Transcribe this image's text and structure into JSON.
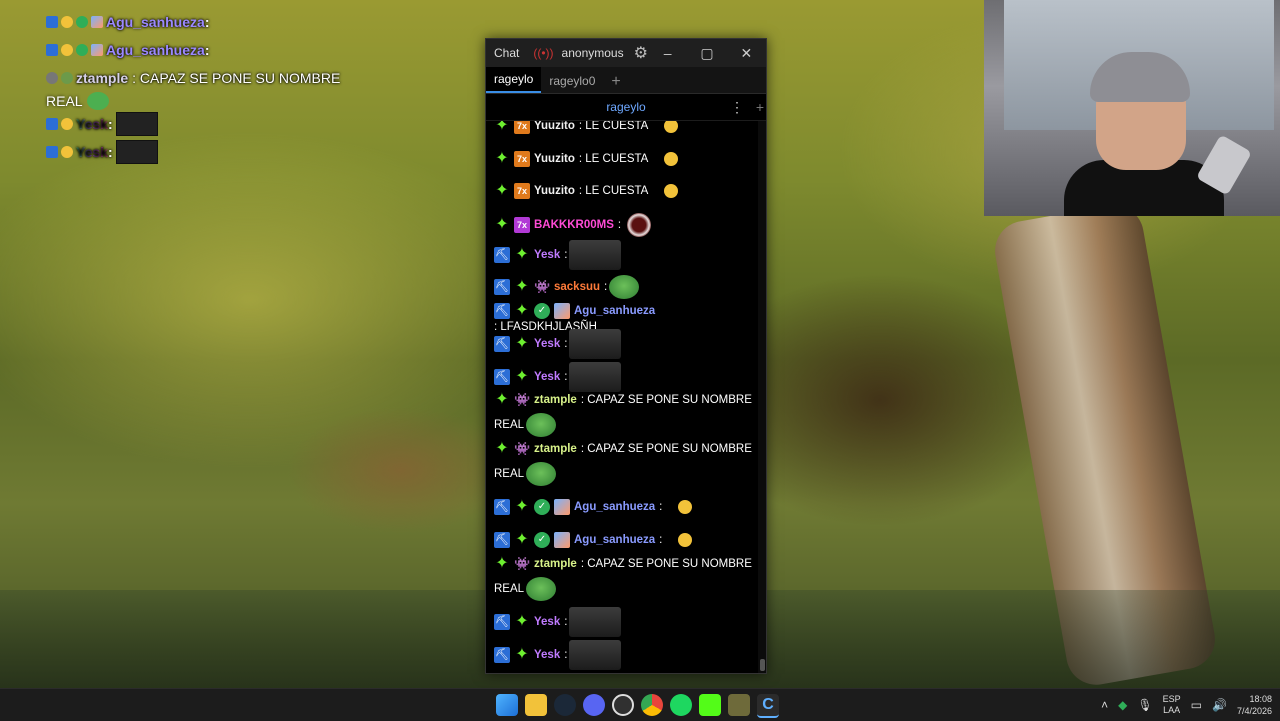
{
  "overlay": {
    "lines": [
      {
        "name": "Agu_sanhueza",
        "suffix": ":"
      },
      {
        "name": "Agu_sanhueza",
        "suffix": ":"
      },
      {
        "name": "ztample",
        "text": ": CAPAZ SE PONE SU NOMBRE"
      },
      {
        "cont": "REAL"
      },
      {
        "name": "Yesk",
        "suffix": ":"
      },
      {
        "name": "Yesk",
        "suffix": ":"
      }
    ]
  },
  "chat_window": {
    "title": "Chat",
    "live_icon": "broadcast-icon",
    "user": "anonymous",
    "minimize": "–",
    "maximize": "▢",
    "close": "✕",
    "tabs": [
      "rageylo",
      "rageylo0"
    ],
    "tab_add": "+",
    "channel": "rageylo",
    "channel_menu": "⋮",
    "channel_add": "+"
  },
  "messages": [
    {
      "user": "Yuuzito",
      "text": ": LE CUESTA"
    },
    {
      "user": "Yuuzito",
      "text": ": LE CUESTA"
    },
    {
      "user": "Yuuzito",
      "text": ": LE CUESTA"
    },
    {
      "user": "BAKKKR00MS",
      "text": ":"
    },
    {
      "user": "Yesk",
      "text": ":"
    },
    {
      "user": "sacksuu",
      "text": ":"
    },
    {
      "user": "Agu_sanhueza",
      "text": ": LFASDKHJLASÑH"
    },
    {
      "user": "Yesk",
      "text": ":"
    },
    {
      "user": "Yesk",
      "text": ":"
    },
    {
      "user": "ztample",
      "text": ": CAPAZ SE PONE SU NOMBRE",
      "cont": "REAL"
    },
    {
      "user": "ztample",
      "text": ": CAPAZ SE PONE SU NOMBRE",
      "cont": "REAL"
    },
    {
      "user": "Agu_sanhueza",
      "text": ":"
    },
    {
      "user": "Agu_sanhueza",
      "text": ":"
    },
    {
      "user": "ztample",
      "text": ": CAPAZ SE PONE SU NOMBRE",
      "cont": "REAL"
    },
    {
      "user": "Yesk",
      "text": ":"
    },
    {
      "user": "Yesk",
      "text": ":"
    }
  ],
  "taskbar": {
    "apps": [
      "windows-start-icon",
      "file-explorer-icon",
      "steam-icon",
      "discord-icon",
      "obs-icon",
      "chrome-icon",
      "spotify-icon",
      "kick-icon",
      "app-icon",
      "chatterino-icon"
    ],
    "lang_top": "ESP",
    "lang_bottom": "LAA",
    "time": "18:08",
    "date": "7/4/2026"
  },
  "colors": {
    "accent": "#3a8ee6",
    "chat_bg": "#000000",
    "channel_link": "#6ea8ff"
  }
}
